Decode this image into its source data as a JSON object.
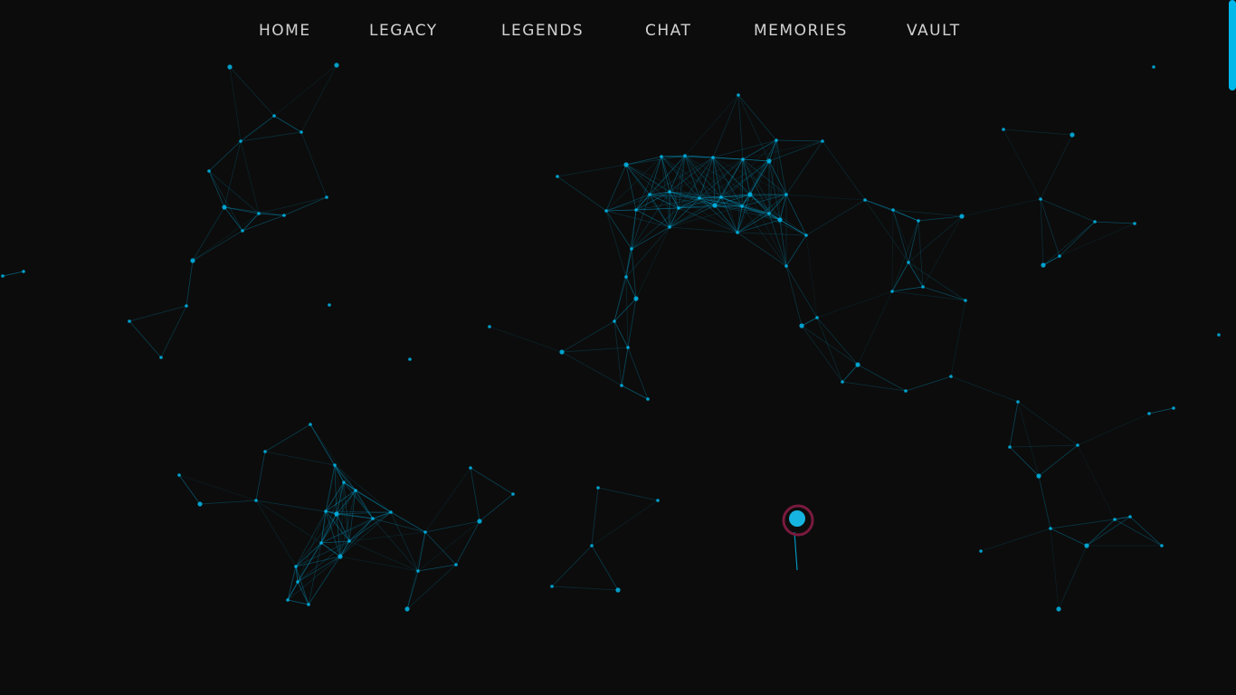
{
  "nav": {
    "items": [
      {
        "label": "HOME"
      },
      {
        "label": "LEGACY"
      },
      {
        "label": "LEGENDS"
      },
      {
        "label": "CHAT"
      },
      {
        "label": "MEMORIES"
      },
      {
        "label": "VAULT"
      }
    ]
  },
  "theme": {
    "background": "#0c0c0c",
    "accent": "#00b7ea",
    "cursor_ring": "#7a1a3e",
    "nav_text": "#d2d2d2"
  },
  "icons": {
    "scroll_thumb": "scrollbar-thumb",
    "pointer": "cursor-dot-icon"
  }
}
